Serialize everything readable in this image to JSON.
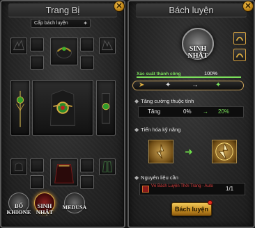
{
  "left_panel": {
    "title": "Trang Bị",
    "level_selector": "Cấp bách luyện",
    "characters": [
      {
        "name_line1": "BỐ",
        "name_line2": "KHIONE",
        "selected": false
      },
      {
        "name_line1": "SINH",
        "name_line2": "NHẬT",
        "selected": true
      },
      {
        "name_line1": "MEDUSA",
        "name_line2": "",
        "selected": false
      }
    ]
  },
  "right_panel": {
    "title": "Bách luyện",
    "emblem": {
      "line1": "SINH",
      "line2": "NHẬT"
    },
    "success_label": "Xác suất thành công",
    "success_rate": "100%",
    "success_fraction": 1.0,
    "sections": {
      "attr": "Tăng cường thuộc tính",
      "skill": "Tiến hóa kỹ năng",
      "material": "Nguyên liệu cần"
    },
    "stat": {
      "label": "Tăng",
      "from": "0%",
      "arrow": "→",
      "to": "20%"
    },
    "material_name": "Vé Bách Luyện Thời Trang - Auto",
    "material_qty": "1/1",
    "button_label": "Bách luyện"
  },
  "colors": {
    "accent_gold": "#d9a441",
    "success_green": "#7be05b",
    "material_red": "#e04040"
  },
  "icons": [
    "close-icon",
    "star-icon",
    "arrow-right-icon",
    "emblem-icon"
  ]
}
